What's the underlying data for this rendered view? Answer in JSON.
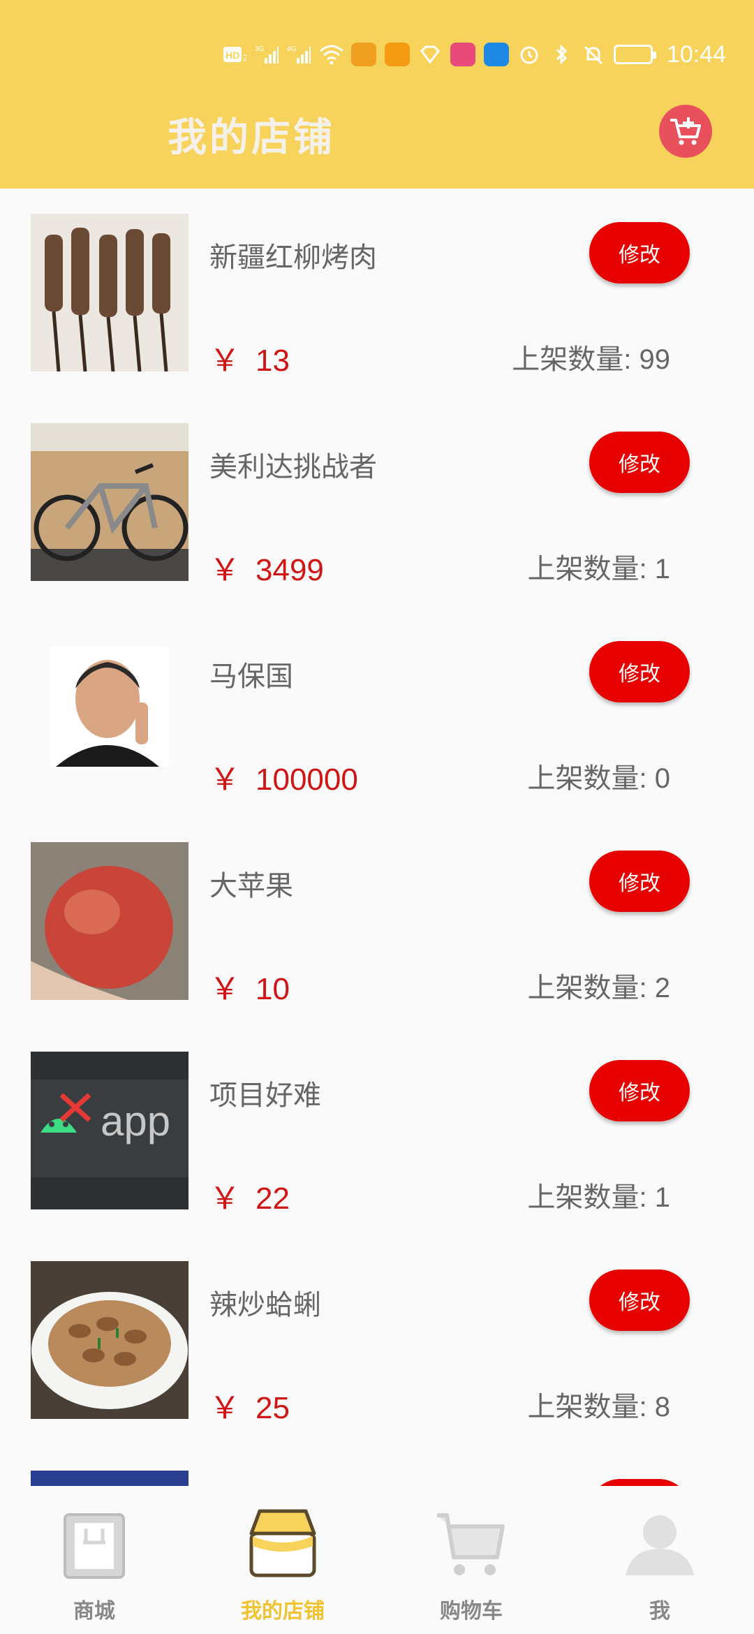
{
  "status_bar": {
    "time": "10:44",
    "icons": [
      "hd-icon",
      "signal-3g-icon",
      "signal-4g-icon",
      "wifi-icon",
      "app-icon",
      "book-icon",
      "heart-icon",
      "app-icon-2",
      "hotspot-icon",
      "alarm-icon",
      "bluetooth-icon",
      "mute-icon",
      "battery-icon"
    ]
  },
  "header": {
    "title": "我的店铺",
    "cart_icon": "add-to-cart-icon",
    "colors": {
      "header_bg": "#f8d35b",
      "accent": "#e60000",
      "fab_bg": "#e8505b"
    }
  },
  "products": [
    {
      "name": "新疆红柳烤肉",
      "currency": "￥",
      "price": "13",
      "stock_label": "上架数量: 99",
      "edit_label": "修改",
      "image": "kebab"
    },
    {
      "name": "美利达挑战者",
      "currency": "￥",
      "price": "3499",
      "stock_label": "上架数量:   1",
      "edit_label": "修改",
      "image": "bicycle"
    },
    {
      "name": "马保国",
      "currency": "￥",
      "price": "100000",
      "stock_label": "上架数量:   0",
      "edit_label": "修改",
      "image": "portrait"
    },
    {
      "name": "大苹果",
      "currency": "￥",
      "price": "10",
      "stock_label": "上架数量:   2",
      "edit_label": "修改",
      "image": "apple"
    },
    {
      "name": "项目好难",
      "currency": "￥",
      "price": "22",
      "stock_label": "上架数量:   1",
      "edit_label": "修改",
      "image": "android-app"
    },
    {
      "name": "辣炒蛤蜊",
      "currency": "￥",
      "price": "25",
      "stock_label": "上架数量:   8",
      "edit_label": "修改",
      "image": "clams"
    }
  ],
  "bottom_nav": {
    "items": [
      {
        "label": "商城",
        "icon": "store-icon"
      },
      {
        "label": "我的店铺",
        "icon": "my-shop-icon",
        "active": true
      },
      {
        "label": "购物车",
        "icon": "cart-icon"
      },
      {
        "label": "我",
        "icon": "profile-icon"
      }
    ]
  }
}
